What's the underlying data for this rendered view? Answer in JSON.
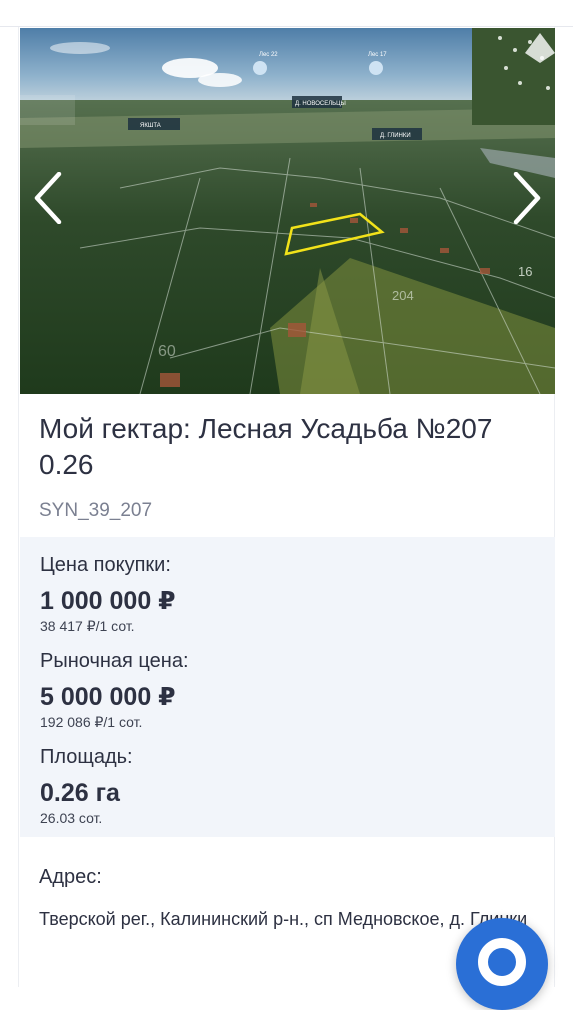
{
  "listing": {
    "title": "Мой гектар: Лесная Усадьба №207 0.26",
    "code": "SYN_39_207",
    "photo_labels": [
      "Лес 22",
      "Лес 17",
      "Д. НОВОСЕЛЬЦЫ",
      "ЯКШТА",
      "Д. ГЛИНКИ"
    ],
    "plot_numbers": [
      "16",
      "204",
      "60"
    ]
  },
  "prices": {
    "purchase": {
      "label": "Цена покупки:",
      "value": "1 000 000 ₽",
      "per_unit": "38 417 ₽/1 сот."
    },
    "market": {
      "label": "Рыночная цена:",
      "value": "5 000 000 ₽",
      "per_unit": "192 086 ₽/1 сот."
    },
    "area": {
      "label": "Площадь:",
      "value": "0.26 га",
      "per_unit": "26.03 сот."
    }
  },
  "address": {
    "label": "Адрес:",
    "value": "Тверской рег., Калининский р-н., сп Медновское, д. Глинки"
  },
  "colors": {
    "accent": "#2a6fd6",
    "price_panel_bg": "#f2f5fa",
    "plot_highlight": "#f2e21a"
  },
  "icons": {
    "prev": "chevron-left-icon",
    "next": "chevron-right-icon",
    "fab": "chat-icon"
  }
}
